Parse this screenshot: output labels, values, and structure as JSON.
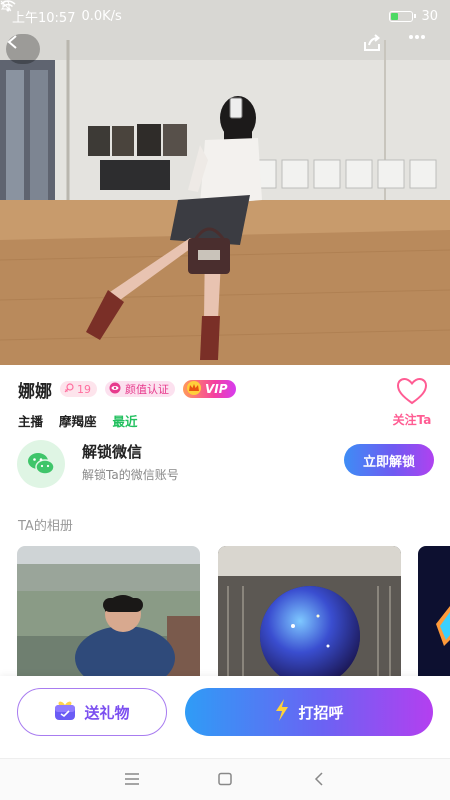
{
  "status_bar": {
    "time": "上午10:57",
    "speed": "0.0K/s",
    "battery": "30"
  },
  "header": {
    "back_icon": "chevron-left-icon",
    "share_icon": "share-icon",
    "more_icon": "more-dots-icon"
  },
  "profile": {
    "name": "娜娜",
    "age": "19",
    "gender_icon": "female-icon",
    "face_verified": "颜值认证",
    "vip": "VIP",
    "tags": [
      "主播",
      "摩羯座",
      "最近"
    ],
    "follow_label": "关注Ta"
  },
  "wechat": {
    "title": "解锁微信",
    "subtitle": "解锁Ta的微信账号",
    "button": "立即解锁"
  },
  "album": {
    "title": "TA的相册"
  },
  "actions": {
    "gift": "送礼物",
    "greet": "打招呼"
  },
  "colors": {
    "accent_pink": "#ff5c93",
    "accent_purple": "#7b4ff0",
    "online_green": "#22c05f"
  }
}
